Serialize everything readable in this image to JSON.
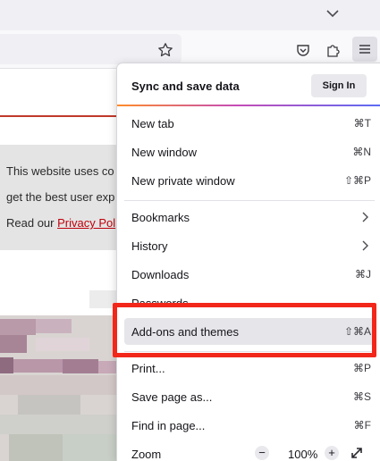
{
  "toolbar": {
    "tab_list_icon": "chevron-down-icon",
    "bookmark_icon": "star-icon",
    "pocket_icon": "pocket-icon",
    "extensions_icon": "puzzle-icon",
    "menu_icon": "hamburger-icon"
  },
  "page": {
    "cookie_line_1": "This website uses co",
    "cookie_line_2": "get the best user exp",
    "cookie_line_3_prefix": "Read our ",
    "cookie_link": "Privacy Pol"
  },
  "menu": {
    "header_title": "Sync and save data",
    "signin_label": "Sign In",
    "items": [
      {
        "label": "New tab",
        "accel": "⌘T"
      },
      {
        "label": "New window",
        "accel": "⌘N"
      },
      {
        "label": "New private window",
        "accel": "⇧⌘P"
      },
      {
        "label": "Bookmarks"
      },
      {
        "label": "History"
      },
      {
        "label": "Downloads",
        "accel": "⌘J"
      },
      {
        "label": "Passwords"
      },
      {
        "label": "Add-ons and themes",
        "accel": "⇧⌘A"
      },
      {
        "label": "Print...",
        "accel": "⌘P"
      },
      {
        "label": "Save page as...",
        "accel": "⌘S"
      },
      {
        "label": "Find in page...",
        "accel": "⌘F"
      },
      {
        "label": "Zoom"
      }
    ],
    "zoom": {
      "minus": "−",
      "value": "100%",
      "plus": "+",
      "fullscreen_icon": "expand-icon"
    }
  },
  "colors": {
    "callout": "#f2271a",
    "highlight_bg": "#e6e6ea",
    "link": "#c0000b",
    "accent_line": "#c0392b"
  }
}
